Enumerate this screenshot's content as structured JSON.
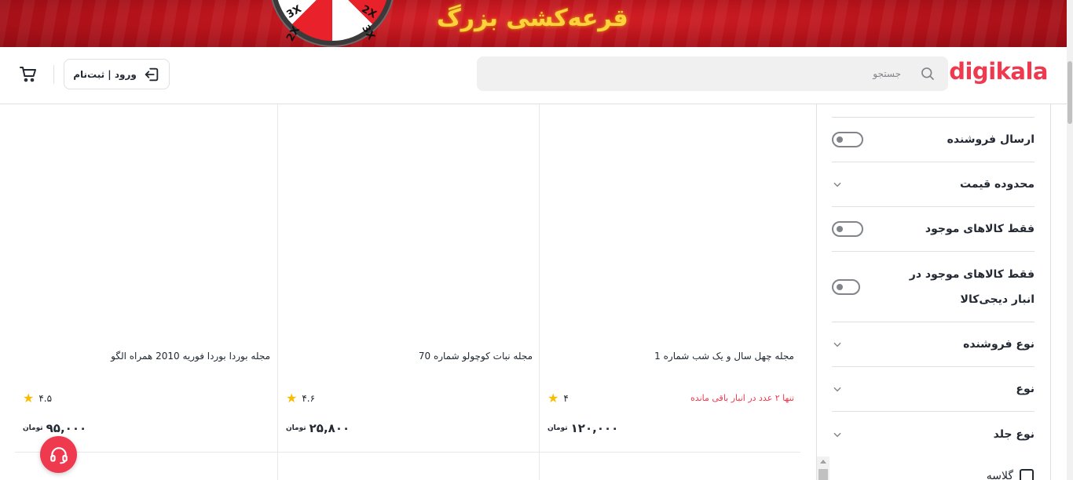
{
  "banner": {
    "title": "قرعه‌کشی بزرگ",
    "wheel_labels": [
      "3X",
      "2X",
      "3X",
      "2X"
    ]
  },
  "header": {
    "logo": "digikala",
    "search_placeholder": "جستجو",
    "login_label": "ورود | ثبت‌نام"
  },
  "filters": [
    {
      "label": "ارسال فروشنده",
      "control": "toggle"
    },
    {
      "label": "محدوده قیمت",
      "control": "chevron"
    },
    {
      "label": "فقط کالاهای موجود",
      "control": "toggle"
    },
    {
      "label": "فقط کالاهای موجود در انبار دیجی‌کالا",
      "control": "toggle"
    },
    {
      "label": "نوع فروشنده",
      "control": "chevron"
    },
    {
      "label": "نوع",
      "control": "chevron"
    },
    {
      "label": "نوع جلد",
      "control": "chevron"
    }
  ],
  "filter_option": {
    "label": "گلاسه"
  },
  "products": [
    {
      "title": "مجله چهل سال و یک شب شماره 1",
      "rating": "۴",
      "stock": "تنها ۲ عدد در انبار باقی مانده",
      "price": "۱۲۰,۰۰۰",
      "currency": "تومان"
    },
    {
      "title": "مجله نبات کوچولو شماره 70",
      "rating": "۴.۶",
      "stock": "",
      "price": "۲۵,۸۰۰",
      "currency": "تومان"
    },
    {
      "title": "مجله بوردا بوردا فوریه 2010 همراه الگو",
      "rating": "۴.۵",
      "stock": "",
      "price": "۹۵,۰۰۰",
      "currency": "تومان"
    }
  ],
  "colors": {
    "brand": "#ef394e",
    "star": "#f9bc00",
    "text": "#232933"
  }
}
